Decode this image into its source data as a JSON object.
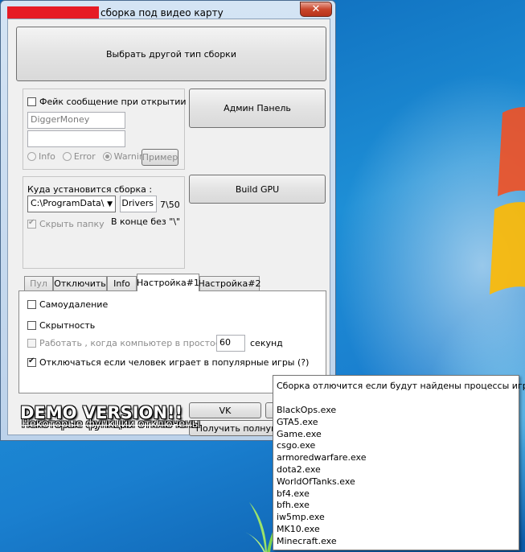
{
  "window": {
    "title": "сборка под видео карту",
    "close_label": "✕"
  },
  "buttons": {
    "choose_type": "Выбрать другой тип сборки",
    "admin_panel": "Админ Панель",
    "build_gpu": "Build GPU",
    "example": "Пример",
    "vk": "VK",
    "get_full": "Получить полную"
  },
  "fake_message": {
    "checkbox_label": "Фейк сообщение при открытии",
    "title_value": "DiggerMoney",
    "text_value": "",
    "radio_info": "Info",
    "radio_error": "Error",
    "radio_warning": "Warning"
  },
  "install": {
    "label": "Куда установится сборка :",
    "path_value": "C:\\ProgramData\\",
    "folder_value": "Drivers",
    "counter": "7\\50",
    "hide_folder": "Скрыть папку",
    "hint": "В конце без \"\\\""
  },
  "tabs": [
    {
      "label": "Пул"
    },
    {
      "label": "Отключить"
    },
    {
      "label": "Info"
    },
    {
      "label": "Настройка#1"
    },
    {
      "label": "Настройка#2"
    }
  ],
  "settings": {
    "self_delete": "Самоудаление",
    "hidden": "Скрытность",
    "idle_prefix": "Работать , когда компьютер в простое :",
    "idle_value": "60",
    "idle_unit": "секунд",
    "games_disconnect": "Отключаться если человек играет в популярные игры (?)"
  },
  "demo": {
    "title": "DEMO VERSION!!",
    "subtitle": "Некоторые функции отключены"
  },
  "popup": {
    "header": "Сборка отлючится если будут найдены процессы игр :",
    "processes": [
      "BlackOps.exe",
      "GTA5.exe",
      "Game.exe",
      "csgo.exe",
      "armoredwarfare.exe",
      "dota2.exe",
      "WorldOfTanks.exe",
      "bf4.exe",
      "bfh.exe",
      "iw5mp.exe",
      "MK10.exe",
      "Minecraft.exe"
    ]
  }
}
